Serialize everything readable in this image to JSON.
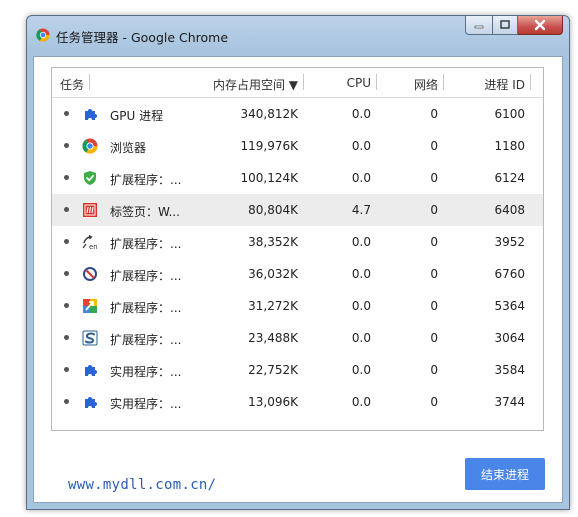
{
  "window": {
    "title": "任务管理器 - Google Chrome",
    "icon": "chrome-icon"
  },
  "columns": {
    "task": "任务",
    "memory": "内存占用空间 ▼",
    "cpu": "CPU",
    "network": "网络",
    "pid": "进程 ID"
  },
  "rows": [
    {
      "icon": "puzzle-icon",
      "name": "GPU 进程",
      "memory": "340,812K",
      "cpu": "0.0",
      "network": "0",
      "pid": "6100"
    },
    {
      "icon": "chrome-icon",
      "name": "浏览器",
      "memory": "119,976K",
      "cpu": "0.0",
      "network": "0",
      "pid": "1180"
    },
    {
      "icon": "green-shield-icon",
      "name": "扩展程序：...",
      "memory": "100,124K",
      "cpu": "0.0",
      "network": "0",
      "pid": "6124"
    },
    {
      "icon": "red-page-icon",
      "name": "标签页：W...",
      "memory": "80,804K",
      "cpu": "4.7",
      "network": "0",
      "pid": "6408"
    },
    {
      "icon": "translate-icon",
      "name": "扩展程序：...",
      "memory": "38,352K",
      "cpu": "0.0",
      "network": "0",
      "pid": "3952"
    },
    {
      "icon": "block-icon",
      "name": "扩展程序：...",
      "memory": "36,032K",
      "cpu": "0.0",
      "network": "0",
      "pid": "6760"
    },
    {
      "icon": "colorful-arrow-icon",
      "name": "扩展程序：...",
      "memory": "31,272K",
      "cpu": "0.0",
      "network": "0",
      "pid": "5364"
    },
    {
      "icon": "s-logo-icon",
      "name": "扩展程序：...",
      "memory": "23,488K",
      "cpu": "0.0",
      "network": "0",
      "pid": "3064"
    },
    {
      "icon": "puzzle-icon",
      "name": "实用程序：...",
      "memory": "22,752K",
      "cpu": "0.0",
      "network": "0",
      "pid": "3584"
    },
    {
      "icon": "puzzle-icon",
      "name": "实用程序：...",
      "memory": "13,096K",
      "cpu": "0.0",
      "network": "0",
      "pid": "3744"
    }
  ],
  "footer": {
    "watermark": "www.mydll.com.cn/",
    "end_process": "结束进程"
  },
  "colors": {
    "accent": "#4a86e8",
    "selected_row": "#ececec",
    "puzzle": "#2a62d8"
  }
}
